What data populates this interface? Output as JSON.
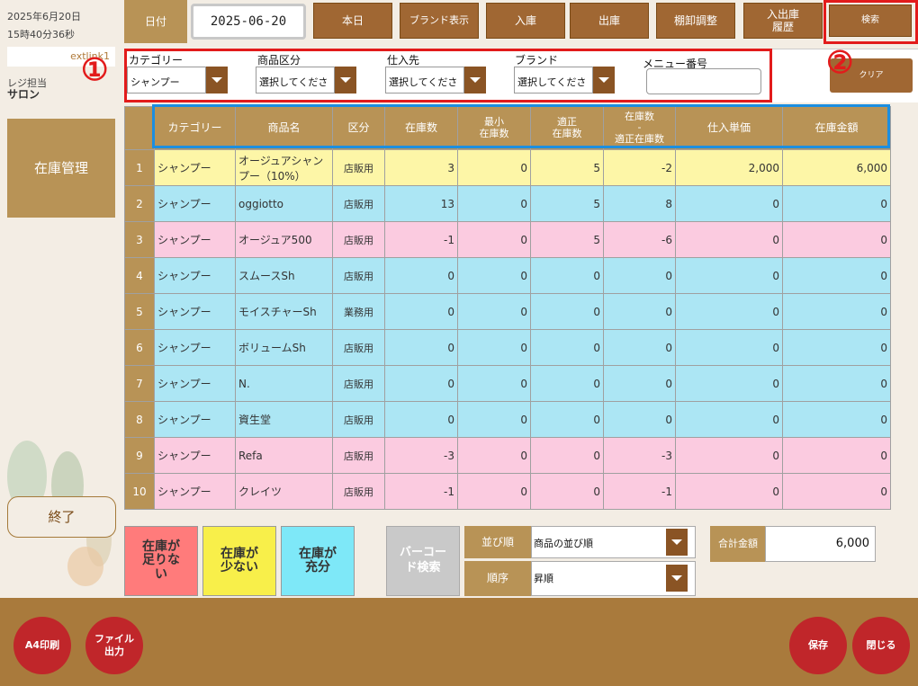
{
  "sidebar": {
    "date": "2025年6月20日",
    "time": "15時40分36秒",
    "ext": "extlink1",
    "staff_label": "レジ担当",
    "staff_name": "サロン",
    "inventory_mgmt": "在庫管理",
    "end": "終了"
  },
  "toolbar": {
    "date_label": "日付",
    "date_value": "2025-06-20",
    "today": "本日",
    "brand_display": "ブランド表示",
    "stock_in": "入庫",
    "stock_out": "出庫",
    "stocktake": "棚卸調整",
    "history": "入出庫\n履歴",
    "search": "検索"
  },
  "filter": {
    "marker1": "①",
    "marker2": "②",
    "category_label": "カテゴリー",
    "category_value": "シャンプー",
    "product_type_label": "商品区分",
    "product_type_value": "選択してくださ",
    "supplier_label": "仕入先",
    "supplier_value": "選択してくださ",
    "brand_label": "ブランド",
    "brand_value": "選択してくださ",
    "menu_no_label": "メニュー番号",
    "menu_no_value": "",
    "clear": "クリア"
  },
  "table": {
    "headers": [
      "カテゴリー",
      "商品名",
      "区分",
      "在庫数",
      "最小\n在庫数",
      "適正\n在庫数",
      "在庫数\n-\n適正在庫数",
      "仕入単価",
      "在庫金額"
    ],
    "rows": [
      {
        "no": "1",
        "category": "シャンプー",
        "name": "オージュアシャンプー（10%）",
        "kubun": "店販用",
        "stock": "3",
        "min": "0",
        "proper": "5",
        "diff": "-2",
        "unit_price": "2,000",
        "amount": "6,000",
        "color": "yellow"
      },
      {
        "no": "2",
        "category": "シャンプー",
        "name": "oggiotto",
        "kubun": "店販用",
        "stock": "13",
        "min": "0",
        "proper": "5",
        "diff": "8",
        "unit_price": "0",
        "amount": "0",
        "color": "blue"
      },
      {
        "no": "3",
        "category": "シャンプー",
        "name": "オージュア500",
        "kubun": "店販用",
        "stock": "-1",
        "min": "0",
        "proper": "5",
        "diff": "-6",
        "unit_price": "0",
        "amount": "0",
        "color": "pink"
      },
      {
        "no": "4",
        "category": "シャンプー",
        "name": "スムースSh",
        "kubun": "店販用",
        "stock": "0",
        "min": "0",
        "proper": "0",
        "diff": "0",
        "unit_price": "0",
        "amount": "0",
        "color": "blue"
      },
      {
        "no": "5",
        "category": "シャンプー",
        "name": "モイスチャーSh",
        "kubun": "業務用",
        "stock": "0",
        "min": "0",
        "proper": "0",
        "diff": "0",
        "unit_price": "0",
        "amount": "0",
        "color": "blue"
      },
      {
        "no": "6",
        "category": "シャンプー",
        "name": "ボリュームSh",
        "kubun": "店販用",
        "stock": "0",
        "min": "0",
        "proper": "0",
        "diff": "0",
        "unit_price": "0",
        "amount": "0",
        "color": "blue"
      },
      {
        "no": "7",
        "category": "シャンプー",
        "name": "N.",
        "kubun": "店販用",
        "stock": "0",
        "min": "0",
        "proper": "0",
        "diff": "0",
        "unit_price": "0",
        "amount": "0",
        "color": "blue"
      },
      {
        "no": "8",
        "category": "シャンプー",
        "name": "資生堂",
        "kubun": "店販用",
        "stock": "0",
        "min": "0",
        "proper": "0",
        "diff": "0",
        "unit_price": "0",
        "amount": "0",
        "color": "blue"
      },
      {
        "no": "9",
        "category": "シャンプー",
        "name": "Refa",
        "kubun": "店販用",
        "stock": "-3",
        "min": "0",
        "proper": "0",
        "diff": "-3",
        "unit_price": "0",
        "amount": "0",
        "color": "pink"
      },
      {
        "no": "10",
        "category": "シャンプー",
        "name": "クレイツ",
        "kubun": "店販用",
        "stock": "-1",
        "min": "0",
        "proper": "0",
        "diff": "-1",
        "unit_price": "0",
        "amount": "0",
        "color": "pink"
      }
    ]
  },
  "legend": {
    "shortage": "在庫が\n足りな\nい",
    "low": "在庫が\n少ない",
    "enough": "在庫が\n充分",
    "shortage_color": "#ff7b7b",
    "low_color": "#f8ef4a",
    "enough_color": "#7ee8f8"
  },
  "barcode": "バーコー\nド検索",
  "sort": {
    "order_label": "並び順",
    "order_value": "商品の並び順",
    "dir_label": "順序",
    "dir_value": "昇順"
  },
  "total": {
    "label": "合計金額",
    "value": "6,000"
  },
  "footer": {
    "a4": "A4印刷",
    "file": "ファイル\n出力",
    "save": "保存",
    "close": "閉じる"
  }
}
